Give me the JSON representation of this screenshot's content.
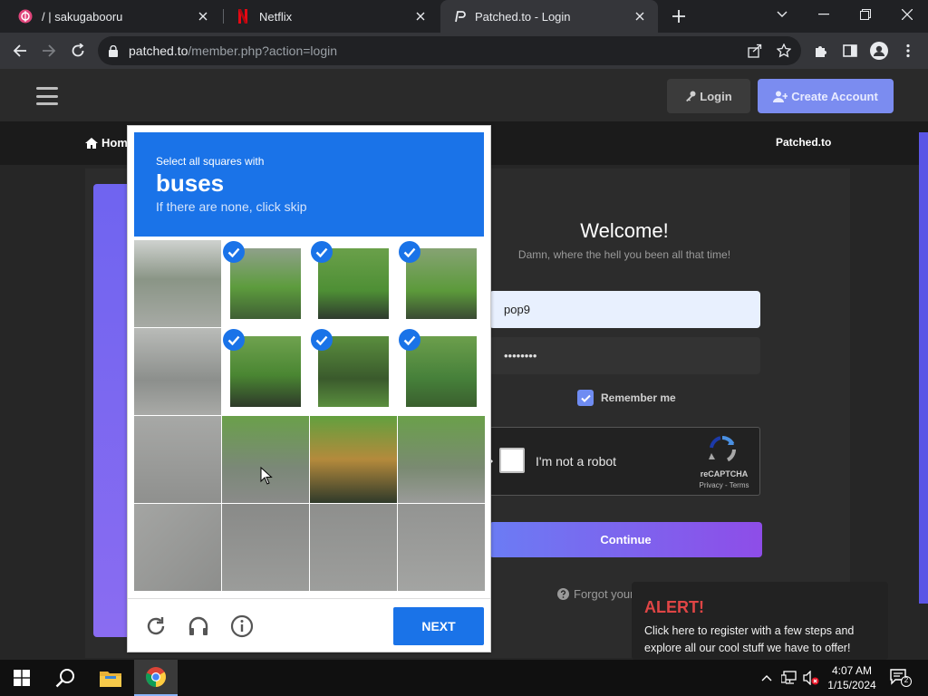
{
  "browser": {
    "tabs": [
      {
        "title": "/ | sakugabooru",
        "active": false
      },
      {
        "title": "Netflix",
        "active": false
      },
      {
        "title": "Patched.to - Login",
        "active": true
      }
    ],
    "url_host": "patched.to",
    "url_path": "/member.php?action=login"
  },
  "site": {
    "header": {
      "login_label": "Login",
      "create_account_label": "Create Account"
    },
    "nav": {
      "home_label": "Home",
      "brand": "Patched.to"
    },
    "login": {
      "welcome": "Welcome!",
      "subtitle": "Damn, where the hell you been all that time!",
      "username_value": "pop9",
      "password_value": "••••••••",
      "remember_label": "Remember me",
      "remember_checked": true,
      "continue_label": "Continue",
      "forgot_label": "Forgot your"
    },
    "recaptcha": {
      "label": "I'm not a robot",
      "brand": "reCAPTCHA",
      "terms": "Privacy - Terms"
    },
    "alert": {
      "title": "ALERT!",
      "text": "Click here to register with a few steps and explore all our cool stuff we have to offer!"
    }
  },
  "challenge": {
    "instruction": "Select all squares with",
    "target": "buses",
    "hint": "If there are none, click skip",
    "tiles": [
      {
        "row": 0,
        "col": 0,
        "selected": false
      },
      {
        "row": 0,
        "col": 1,
        "selected": true
      },
      {
        "row": 0,
        "col": 2,
        "selected": true
      },
      {
        "row": 0,
        "col": 3,
        "selected": true
      },
      {
        "row": 1,
        "col": 0,
        "selected": false
      },
      {
        "row": 1,
        "col": 1,
        "selected": true
      },
      {
        "row": 1,
        "col": 2,
        "selected": true
      },
      {
        "row": 1,
        "col": 3,
        "selected": true
      },
      {
        "row": 2,
        "col": 0,
        "selected": false
      },
      {
        "row": 2,
        "col": 1,
        "selected": false
      },
      {
        "row": 2,
        "col": 2,
        "selected": false
      },
      {
        "row": 2,
        "col": 3,
        "selected": false
      },
      {
        "row": 3,
        "col": 0,
        "selected": false
      },
      {
        "row": 3,
        "col": 1,
        "selected": false
      },
      {
        "row": 3,
        "col": 2,
        "selected": false
      },
      {
        "row": 3,
        "col": 3,
        "selected": false
      }
    ],
    "next_label": "NEXT",
    "footer_icons": [
      "reload-icon",
      "headphones-icon",
      "info-icon"
    ]
  },
  "taskbar": {
    "time": "4:07 AM",
    "date": "1/15/2024",
    "notification_count": "2"
  },
  "colors": {
    "captcha_blue": "#1a73e8",
    "create_account": "#7b8cf0",
    "alert_red": "#e04545"
  }
}
